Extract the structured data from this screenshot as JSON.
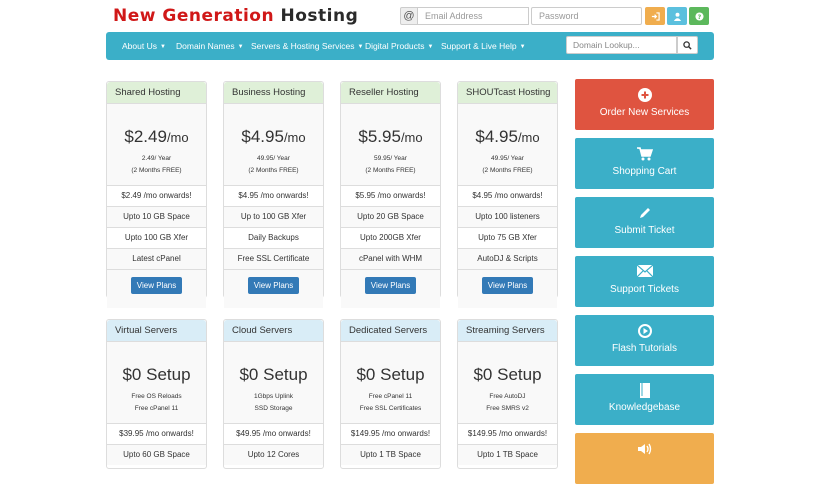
{
  "logo": {
    "part1": "New Generation",
    "part2": "Hosting"
  },
  "login": {
    "email_placeholder": "Email Address",
    "password_placeholder": "Password",
    "at_symbol": "@"
  },
  "nav": {
    "items": [
      {
        "label": "About Us"
      },
      {
        "label": "Domain Names"
      },
      {
        "label": "Servers & Hosting Services"
      },
      {
        "label": "Digital Products"
      },
      {
        "label": "Support & Live Help"
      }
    ],
    "lookup_placeholder": "Domain Lookup..."
  },
  "plans_top": [
    {
      "name": "Shared Hosting",
      "price": "$2.49",
      "unit": "/mo",
      "sub1": "2.49/ Year",
      "sub2": "(2 Months FREE)",
      "features": [
        "$2.49 /mo onwards!",
        "Upto 10 GB Space",
        "Upto 100 GB Xfer",
        "Latest cPanel"
      ],
      "button": "View Plans"
    },
    {
      "name": "Business Hosting",
      "price": "$4.95",
      "unit": "/mo",
      "sub1": "49.95/ Year",
      "sub2": "(2 Months FREE)",
      "features": [
        "$4.95 /mo onwards!",
        "Up to 100 GB Xfer",
        "Daily Backups",
        "Free SSL Certificate"
      ],
      "button": "View Plans"
    },
    {
      "name": "Reseller Hosting",
      "price": "$5.95",
      "unit": "/mo",
      "sub1": "59.95/ Year",
      "sub2": "(2 Months FREE)",
      "features": [
        "$5.95 /mo onwards!",
        "Upto 20 GB Space",
        "Upto 200GB Xfer",
        "cPanel with WHM"
      ],
      "button": "View Plans"
    },
    {
      "name": "SHOUTcast Hosting",
      "price": "$4.95",
      "unit": "/mo",
      "sub1": "49.95/ Year",
      "sub2": "(2 Months FREE)",
      "features": [
        "$4.95 /mo onwards!",
        "Upto 100 listeners",
        "Upto 75 GB Xfer",
        "AutoDJ & Scripts"
      ],
      "button": "View Plans"
    }
  ],
  "plans_bottom": [
    {
      "name": "Virtual Servers",
      "price": "$0 Setup",
      "sub1": "Free OS Reloads",
      "sub2": "Free cPanel 11",
      "features": [
        "$39.95 /mo onwards!",
        "Upto 60 GB Space"
      ]
    },
    {
      "name": "Cloud Servers",
      "price": "$0 Setup",
      "sub1": "1Gbps Uplink",
      "sub2": "SSD Storage",
      "features": [
        "$49.95 /mo onwards!",
        "Upto 12 Cores"
      ]
    },
    {
      "name": "Dedicated Servers",
      "price": "$0 Setup",
      "sub1": "Free cPanel 11",
      "sub2": "Free SSL Certificates",
      "features": [
        "$149.95 /mo onwards!",
        "Upto 1 TB Space"
      ]
    },
    {
      "name": "Streaming Servers",
      "price": "$0 Setup",
      "sub1": "Free AutoDJ",
      "sub2": "Free SMRS v2",
      "features": [
        "$149.95 /mo onwards!",
        "Upto 1 TB Space"
      ]
    }
  ],
  "tiles": [
    {
      "label": "Order New Services",
      "icon": "plus-circle-icon",
      "color": "#df5440"
    },
    {
      "label": "Shopping Cart",
      "icon": "shopping-cart-icon",
      "color": "#3bafc8"
    },
    {
      "label": "Submit Ticket",
      "icon": "pencil-icon",
      "color": "#3bafc8"
    },
    {
      "label": "Support Tickets",
      "icon": "envelope-icon",
      "color": "#3bafc8"
    },
    {
      "label": "Flash Tutorials",
      "icon": "play-circle-icon",
      "color": "#3bafc8"
    },
    {
      "label": "Knowledgebase",
      "icon": "book-icon",
      "color": "#3bafc8"
    },
    {
      "label": "",
      "icon": "speaker-icon",
      "color": "#f0ad4e"
    }
  ]
}
